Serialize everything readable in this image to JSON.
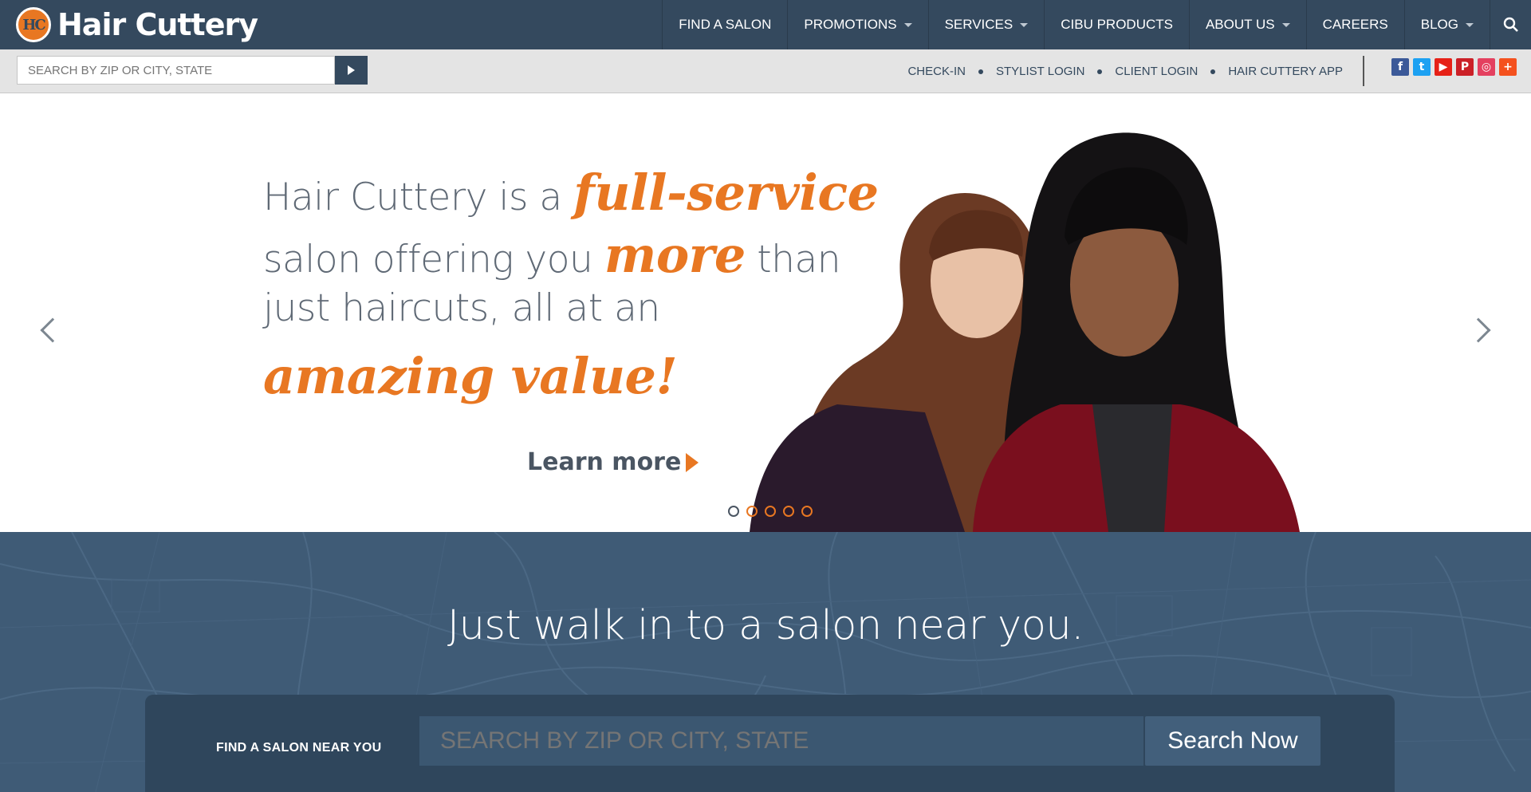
{
  "brand": {
    "name": "Hair Cuttery",
    "badge": "HC"
  },
  "nav": {
    "items": [
      {
        "label": "FIND A SALON",
        "dropdown": false
      },
      {
        "label": "PROMOTIONS",
        "dropdown": true
      },
      {
        "label": "SERVICES",
        "dropdown": true
      },
      {
        "label": "CIBU PRODUCTS",
        "dropdown": false
      },
      {
        "label": "ABOUT US",
        "dropdown": true
      },
      {
        "label": "CAREERS",
        "dropdown": false
      },
      {
        "label": "BLOG",
        "dropdown": true
      }
    ],
    "search_icon": "search-icon"
  },
  "subbar": {
    "search_placeholder": "SEARCH BY ZIP OR CITY, STATE",
    "links": [
      "CHECK-IN",
      "STYLIST LOGIN",
      "CLIENT LOGIN",
      "HAIR CUTTERY APP"
    ],
    "socials": [
      {
        "icon": "facebook-icon",
        "glyph": "f",
        "color": "#3b5998"
      },
      {
        "icon": "twitter-icon",
        "glyph": "t",
        "color": "#1da1f2"
      },
      {
        "icon": "youtube-icon",
        "glyph": "▶",
        "color": "#e62117"
      },
      {
        "icon": "pinterest-icon",
        "glyph": "P",
        "color": "#cb2027"
      },
      {
        "icon": "instagram-icon",
        "glyph": "◎",
        "color": "#e4405f"
      },
      {
        "icon": "google-plus-icon",
        "glyph": "+",
        "color": "#f4511e"
      }
    ]
  },
  "hero": {
    "line1_pre": "Hair Cuttery is a ",
    "line1_accent": "full-service",
    "line2_pre": "salon offering you ",
    "line2_accent": "more",
    "line2_post": " than",
    "line3": "just haircuts, all at an",
    "line4_accent": "amazing value!",
    "cta": "Learn more",
    "slide_count": 5,
    "active_slide": 1
  },
  "locator": {
    "heading": "Just walk in to a salon near you.",
    "label": "FIND A SALON NEAR YOU",
    "placeholder": "SEARCH BY ZIP OR CITY, STATE",
    "button": "Search Now"
  },
  "colors": {
    "navy": "#34495e",
    "orange": "#e87722",
    "locator_bg": "#3f5b76"
  }
}
